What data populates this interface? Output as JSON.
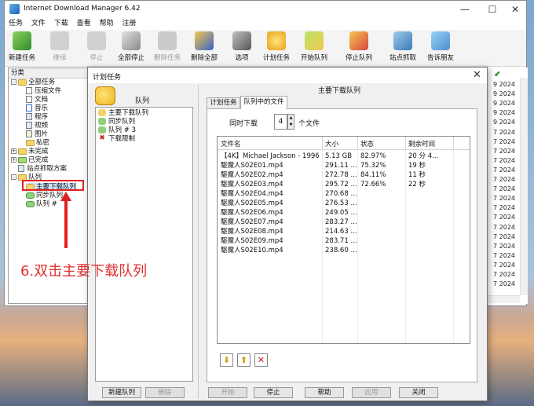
{
  "app": {
    "title": "Internet Download Manager 6.42"
  },
  "window_controls": {
    "min": "—",
    "max": "☐",
    "close": "✕"
  },
  "menu": [
    "任务",
    "文件",
    "下载",
    "查看",
    "帮助",
    "注册"
  ],
  "toolbar": {
    "new_task": "新建任务",
    "resume": "继续",
    "stop": "停止",
    "stop_all": "全部停止",
    "delete_task": "删除任务",
    "delete_all": "删除全部",
    "options": "选项",
    "scheduler": "计划任务",
    "start_queue": "开始队列",
    "stop_queue": "停止队列",
    "grabber": "站点抓取",
    "tell_friend": "告诉朋友"
  },
  "categories": {
    "header": "分类",
    "all": "全部任务",
    "compressed": "压缩文件",
    "docs": "文档",
    "music": "音乐",
    "programs": "程序",
    "video": "视频",
    "images": "图片",
    "private": "私密",
    "unfinished": "未完成",
    "finished": "已完成",
    "grabber": "站点抓取方案",
    "queues": "队列",
    "main_queue": "主要下载队列",
    "sync_queue": "同步队列",
    "queue_n": "队列 #"
  },
  "bg_list": {
    "dates": [
      "9 2024",
      "9 2024",
      "9 2024",
      "9 2024",
      "9 2024",
      "7 2024",
      "7 2024",
      "7 2024",
      "7 2024",
      "7 2024",
      "7 2024",
      "7 2024",
      "7 2024",
      "7 2024",
      "7 2024",
      "7 2024",
      "7 2024",
      "7 2024",
      "7 2024",
      "7 2024",
      "7 2024",
      "7 2024"
    ]
  },
  "dialog": {
    "title": "计划任务",
    "close": "✕",
    "queue_label": "队列",
    "queues": [
      "主要下载队列",
      "同步队列",
      "队列 # 3",
      "下载限制"
    ],
    "main_title": "主要下载队列",
    "tabs": {
      "schedule": "计划任务",
      "files": "队列中的文件"
    },
    "concurrent": {
      "label": "同时下载",
      "value": "4",
      "unit": "个文件"
    },
    "columns": [
      "文件名",
      "大小",
      "状态",
      "剩余时间"
    ],
    "files": [
      {
        "name": "【4K】Michael Jackson - 1996 ...",
        "size": "5.13  GB",
        "status": "82.97%",
        "remaining": "20 分 4..."
      },
      {
        "name": "駆魔人S02E01.mp4",
        "size": "291.11 ...",
        "status": "75.32%",
        "remaining": "19 秒"
      },
      {
        "name": "駆魔人S02E02.mp4",
        "size": "272.78 ...",
        "status": "84.11%",
        "remaining": "11 秒"
      },
      {
        "name": "駆魔人S02E03.mp4",
        "size": "295.72 ...",
        "status": "72.66%",
        "remaining": "22 秒"
      },
      {
        "name": "駆魔人S02E04.mp4",
        "size": "270.68 ...",
        "status": "",
        "remaining": ""
      },
      {
        "name": "駆魔人S02E05.mp4",
        "size": "276.53 ...",
        "status": "",
        "remaining": ""
      },
      {
        "name": "駆魔人S02E06.mp4",
        "size": "249.05 ...",
        "status": "",
        "remaining": ""
      },
      {
        "name": "駆魔人S02E07.mp4",
        "size": "283.27 ...",
        "status": "",
        "remaining": ""
      },
      {
        "name": "駆魔人S02E08.mp4",
        "size": "214.63 ...",
        "status": "",
        "remaining": ""
      },
      {
        "name": "駆魔人S02E09.mp4",
        "size": "283.71 ...",
        "status": "",
        "remaining": ""
      },
      {
        "name": "駆魔人S02E10.mp4",
        "size": "238.60 ...",
        "status": "",
        "remaining": ""
      }
    ],
    "buttons": {
      "new_queue": "新建队列",
      "delete": "删除",
      "start": "开始",
      "stop": "停止",
      "help": "帮助",
      "apply": "应用",
      "close": "关闭"
    }
  },
  "annotation": {
    "text": "6.双击主要下载队列",
    "color": "#e03030"
  },
  "colors": {
    "accent": "#e02020",
    "queue_green": "#5cb85c",
    "queue_yellow": "#f2d36c"
  }
}
